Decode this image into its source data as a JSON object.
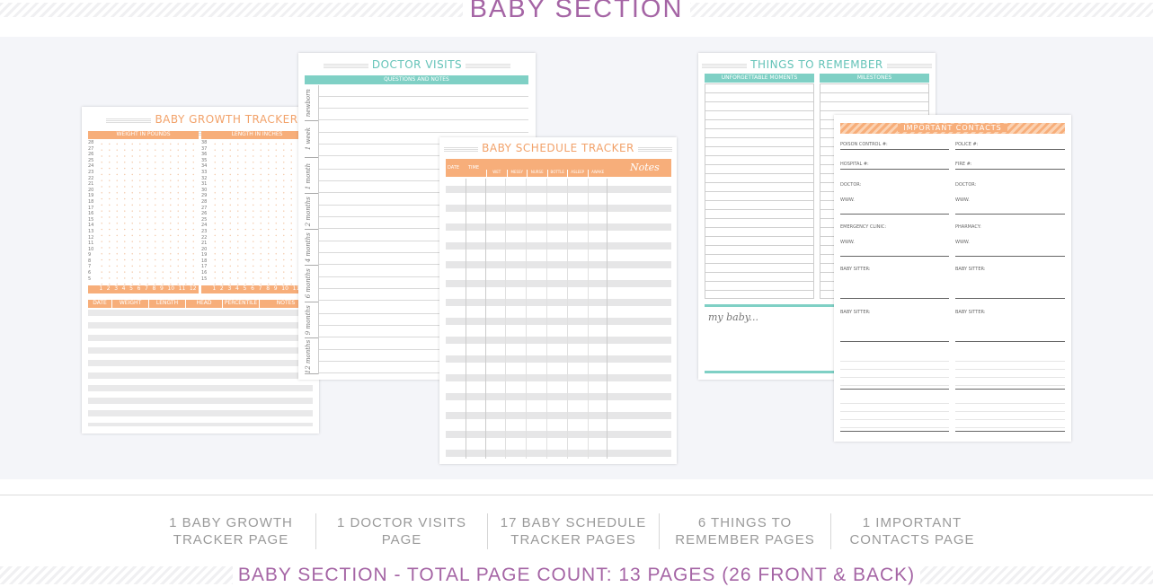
{
  "header": {
    "title": "BABY SECTION"
  },
  "sheets": {
    "growth": {
      "title": "BABY GROWTH TRACKER",
      "weight_label": "WEIGHT IN POUNDS",
      "length_label": "LENGTH IN INCHES",
      "weight_scale": [
        "28",
        "27",
        "26",
        "25",
        "24",
        "23",
        "22",
        "21",
        "20",
        "19",
        "18",
        "17",
        "16",
        "15",
        "14",
        "13",
        "12",
        "11",
        "10",
        "9",
        "8",
        "7",
        "6",
        "5"
      ],
      "length_scale": [
        "38",
        "37",
        "36",
        "35",
        "34",
        "33",
        "32",
        "31",
        "30",
        "29",
        "28",
        "27",
        "26",
        "25",
        "24",
        "23",
        "22",
        "21",
        "20",
        "19",
        "18",
        "17",
        "16",
        "15"
      ],
      "months": [
        "1",
        "2",
        "3",
        "4",
        "5",
        "6",
        "7",
        "8",
        "9",
        "10",
        "11",
        "12"
      ],
      "table_headers": [
        "DATE",
        "WEIGHT",
        "LENGTH",
        "HEAD",
        "PERCENTILE",
        "NOTES"
      ]
    },
    "doctor": {
      "title": "DOCTOR VISITS",
      "questions_label": "QUESTIONS AND NOTES",
      "periods": [
        "newborn",
        "1 week",
        "1 month",
        "2 months",
        "4 months",
        "6 months",
        "9 months",
        "12 months"
      ]
    },
    "schedule": {
      "title": "BABY SCHEDULE TRACKER",
      "headers": [
        "DATE",
        "TIME"
      ],
      "sub_headers": [
        "WET",
        "MESSY",
        "NURSE",
        "BOTTLE",
        "ASLEEP",
        "AWAKE"
      ],
      "notes_label": "Notes"
    },
    "remember": {
      "title": "THINGS TO REMEMBER",
      "col1": "UNFORGETTABLE MOMENTS",
      "col2": "MILESTONES",
      "my_baby": "my baby..."
    },
    "contacts": {
      "title": "IMPORTANT CONTACTS",
      "left_fields": [
        "POISON CONTROL #:",
        "HOSPITAL #:",
        "DOCTOR:",
        "EMERGENCY CLINIC:",
        "BABY SITTER:",
        "BABY SITTER:"
      ],
      "right_fields": [
        "POLICE #:",
        "FIRE #:",
        "DOCTOR:",
        "PHARMACY:",
        "BABY SITTER:",
        "BABY SITTER:"
      ],
      "www_label": "WWW."
    }
  },
  "stats": [
    {
      "line1": "1 BABY GROWTH",
      "line2": "TRACKER PAGE"
    },
    {
      "line1": "1 DOCTOR VISITS",
      "line2": "PAGE"
    },
    {
      "line1": "17 BABY SCHEDULE",
      "line2": "TRACKER PAGES"
    },
    {
      "line1": "6 THINGS TO",
      "line2": "REMEMBER PAGES"
    },
    {
      "line1": "1 IMPORTANT",
      "line2": "CONTACTS PAGE"
    }
  ],
  "footer": {
    "total": "BABY SECTION - TOTAL PAGE COUNT: 13 PAGES (26 FRONT & BACK)"
  },
  "colors": {
    "purple": "#a565a5",
    "orange": "#f7ae7a",
    "teal": "#7fd0c5"
  }
}
